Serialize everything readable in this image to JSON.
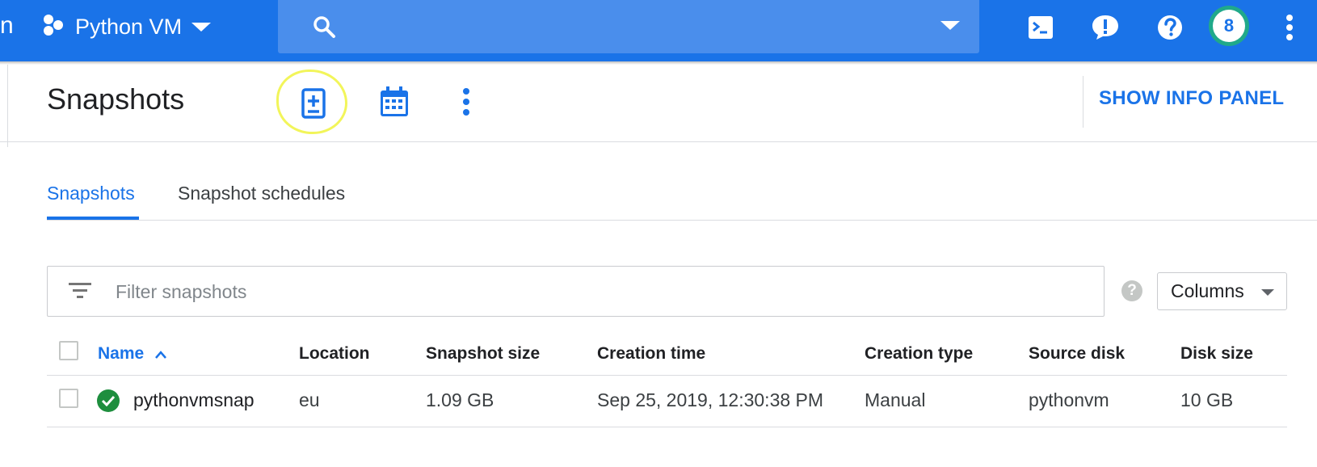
{
  "topbar": {
    "nav_fragment": "n",
    "project_name": "Python VM",
    "search_placeholder": "",
    "avatar_initial": "8",
    "icons": [
      "cloud-shell-icon",
      "feedback-icon",
      "help-icon",
      "account-avatar",
      "more-vert-icon"
    ]
  },
  "header": {
    "title": "Snapshots",
    "actions": [
      "create-snapshot-icon",
      "create-schedule-icon",
      "more-vert-icon"
    ],
    "info_panel_label": "SHOW INFO PANEL"
  },
  "tabs": [
    {
      "label": "Snapshots",
      "active": true
    },
    {
      "label": "Snapshot schedules",
      "active": false
    }
  ],
  "filter": {
    "placeholder": "Filter snapshots",
    "value": "",
    "columns_label": "Columns"
  },
  "table": {
    "columns": [
      "Name",
      "Location",
      "Snapshot size",
      "Creation time",
      "Creation type",
      "Source disk",
      "Disk size"
    ],
    "sort": {
      "column": "Name",
      "direction": "ascending"
    },
    "rows": [
      {
        "status": "ok",
        "name": "pythonvmsnap",
        "location": "eu",
        "snapshot_size": "1.09 GB",
        "creation_time": "Sep 25, 2019, 12:30:38 PM",
        "creation_type": "Manual",
        "source_disk": "pythonvm",
        "disk_size": "10 GB"
      }
    ]
  },
  "colors": {
    "brand_blue": "#1a73e8",
    "search_bg": "#4a8eec",
    "avatar_ring": "#20a98a",
    "status_green": "#1e8e3e",
    "highlight_yellow": "#f2f55a"
  }
}
